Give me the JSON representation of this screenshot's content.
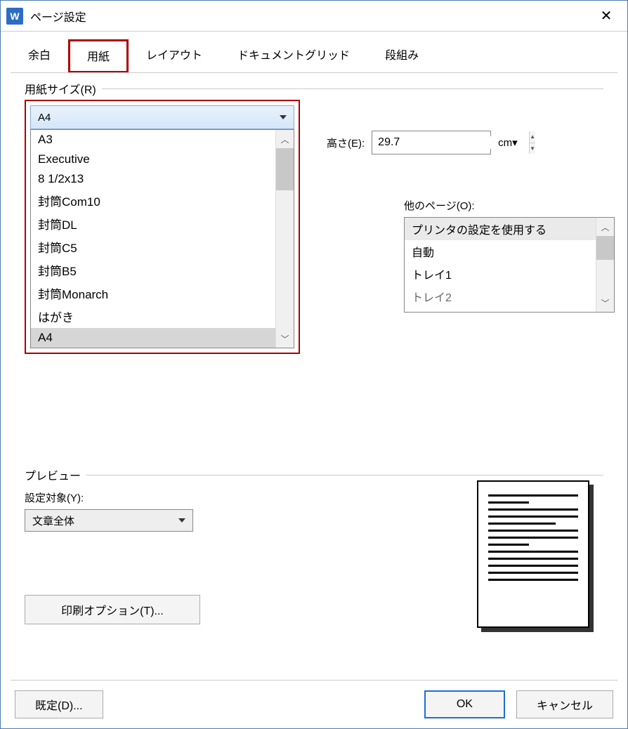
{
  "window": {
    "title": "ページ設定",
    "app_icon_letter": "W"
  },
  "tabs": {
    "margin": "余白",
    "paper": "用紙",
    "layout": "レイアウト",
    "grid": "ドキュメントグリッド",
    "columns": "段組み"
  },
  "paper_size": {
    "label": "用紙サイズ(R)",
    "selected": "A4",
    "options": [
      "A3",
      "Executive",
      "8 1/2x13",
      "封筒Com10",
      "封筒DL",
      "封筒C5",
      "封筒B5",
      "封筒Monarch",
      "はがき",
      "A4"
    ]
  },
  "height": {
    "label": "高さ(E):",
    "value": "29.7",
    "unit": "cm▾"
  },
  "other_pages": {
    "label": "他のページ(O):",
    "items": [
      "プリンタの設定を使用する",
      "自動",
      "トレイ1",
      "トレイ2"
    ]
  },
  "preview": {
    "section_label": "プレビュー",
    "target_label": "設定対象(Y):",
    "target_value": "文章全体",
    "print_options": "印刷オプション(T)..."
  },
  "buttons": {
    "default": "既定(D)...",
    "ok": "OK",
    "cancel": "キャンセル"
  }
}
